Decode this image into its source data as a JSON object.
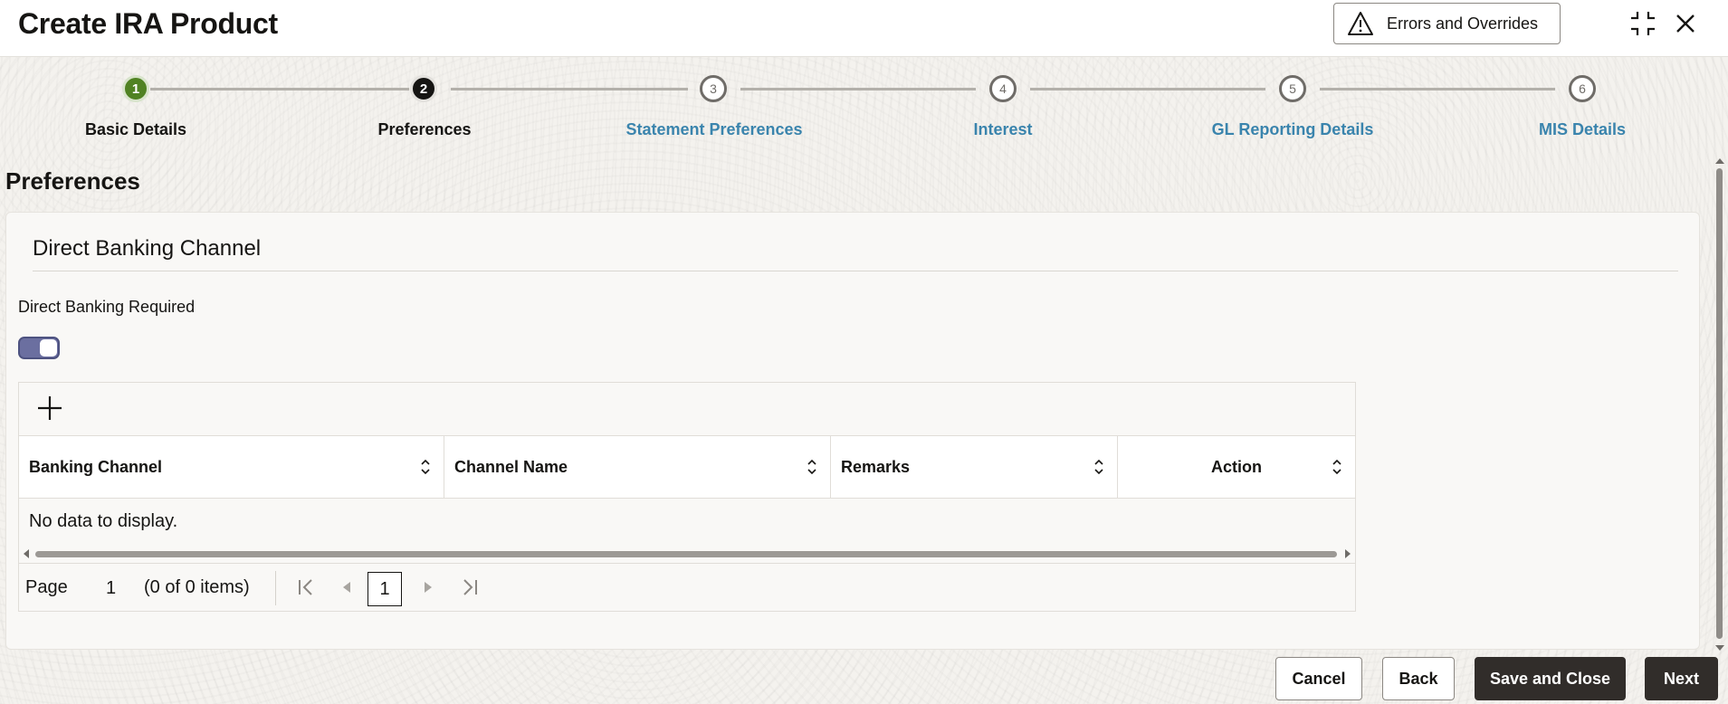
{
  "header": {
    "title": "Create IRA Product",
    "errors_button_label": "Errors and Overrides"
  },
  "train": {
    "steps": [
      {
        "number": "1",
        "label": "Basic Details",
        "state": "done"
      },
      {
        "number": "2",
        "label": "Preferences",
        "state": "current"
      },
      {
        "number": "3",
        "label": "Statement Preferences",
        "state": "todo"
      },
      {
        "number": "4",
        "label": "Interest",
        "state": "todo"
      },
      {
        "number": "5",
        "label": "GL Reporting Details",
        "state": "todo"
      },
      {
        "number": "6",
        "label": "MIS Details",
        "state": "todo"
      }
    ]
  },
  "section": {
    "title": "Preferences",
    "panel_heading": "Direct Banking Channel",
    "toggle_label": "Direct Banking Required",
    "toggle_on": true
  },
  "table": {
    "columns": [
      "Banking Channel",
      "Channel Name",
      "Remarks",
      "Action"
    ],
    "rows": [],
    "empty_text": "No data to display.",
    "pager": {
      "page_label": "Page",
      "page_number": "1",
      "items_text": "(0 of 0 items)",
      "current_page": "1"
    }
  },
  "footer": {
    "cancel": "Cancel",
    "back": "Back",
    "save_close": "Save and Close",
    "next": "Next"
  },
  "colors": {
    "step_done": "#508223",
    "step_current": "#161513",
    "step_link": "#3a84ad",
    "toggle_on": "#6b6fa0",
    "primary_button": "#312d2a"
  }
}
